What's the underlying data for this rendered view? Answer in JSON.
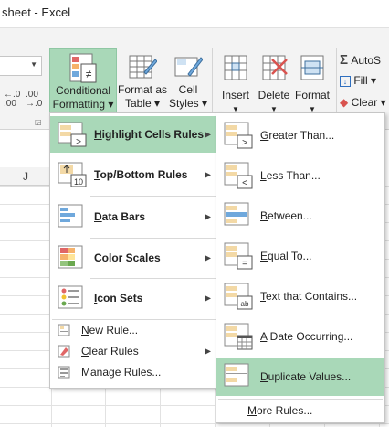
{
  "window": {
    "title": "sheet - Excel"
  },
  "ribbon": {
    "conditional_formatting": {
      "line1": "Conditional",
      "line2": "Formatting ▾"
    },
    "format_as_table": {
      "line1": "Format as",
      "line2": "Table ▾"
    },
    "cell_styles": {
      "line1": "Cell",
      "line2": "Styles ▾"
    },
    "insert": {
      "label": "Insert"
    },
    "delete": {
      "label": "Delete"
    },
    "format": {
      "label": "Format"
    },
    "autosum": {
      "label": "AutoS"
    },
    "fill": {
      "label": "Fill ▾"
    },
    "clear": {
      "label": "Clear ▾"
    },
    "increase_decimal": ".00\n→.0",
    "decrease_decimal": ".00\n→.0"
  },
  "grid": {
    "column_header": "J"
  },
  "menu_main": {
    "items": [
      {
        "label": "Highlight Cells Rules",
        "underline": "H",
        "rest": "ighlight Cells Rules",
        "submenu": true,
        "highlighted": true
      },
      {
        "label": "Top/Bottom Rules",
        "underline": "T",
        "rest": "op/Bottom Rules",
        "submenu": true
      },
      {
        "label": "Data Bars",
        "underline": "D",
        "rest": "ata Bars",
        "submenu": true
      },
      {
        "label": "Color Scales",
        "underline": "S",
        "rest": "Color Scales",
        "submenu": true
      },
      {
        "label": "Icon Sets",
        "underline": "I",
        "rest": "con Sets",
        "submenu": true
      },
      {
        "label": "New Rule...",
        "underline": "N",
        "rest": "ew Rule...",
        "submenu": false
      },
      {
        "label": "Clear Rules",
        "underline": "C",
        "rest": "lear Rules",
        "submenu": true
      },
      {
        "label": "Manage Rules...",
        "underline": "R",
        "rest": "Manage Rules...",
        "submenu": false
      }
    ]
  },
  "menu_sub": {
    "items": [
      {
        "underline": "G",
        "rest": "reater Than..."
      },
      {
        "underline": "L",
        "rest": "ess Than..."
      },
      {
        "underline": "B",
        "rest": "etween..."
      },
      {
        "underline": "E",
        "rest": "qual To..."
      },
      {
        "underline": "T",
        "rest": "ext that Contains..."
      },
      {
        "underline": "A",
        "rest": " Date Occurring..."
      },
      {
        "underline": "D",
        "rest": "uplicate Values...",
        "highlighted": true
      }
    ],
    "more_rules": {
      "prefix": "",
      "underline": "M",
      "rest": "ore Rules..."
    }
  },
  "colors": {
    "accent": "#a9d8b8",
    "accent_border": "#8fc7a3",
    "ribbon_bg": "#f3f3f3"
  }
}
